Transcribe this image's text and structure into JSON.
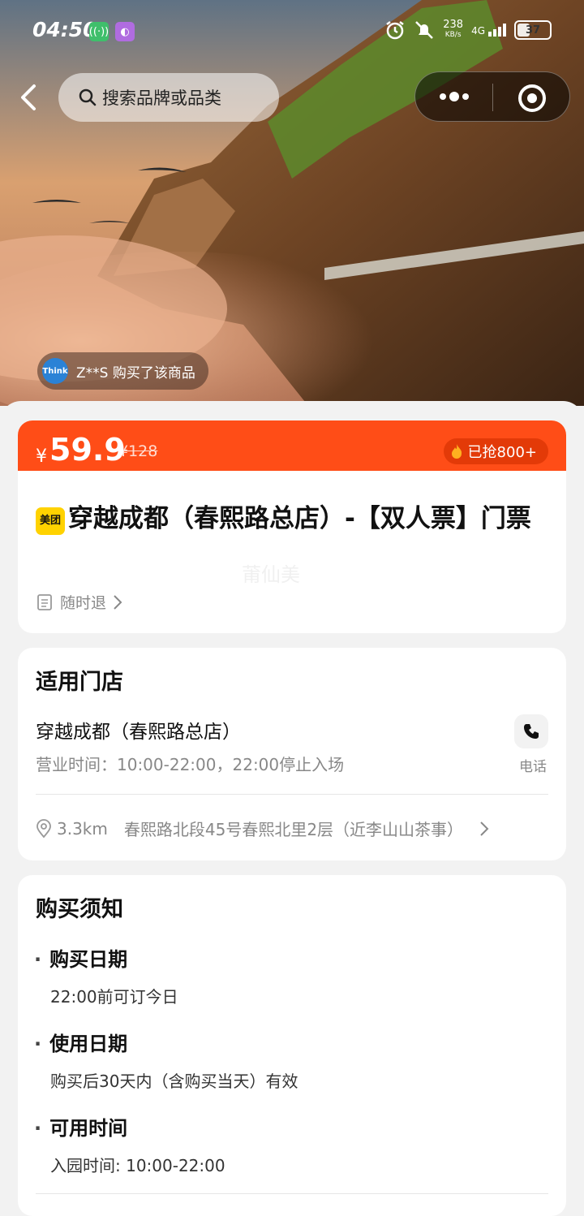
{
  "status_bar": {
    "time": "04:50",
    "net_speed": "238",
    "net_unit": "KB/s",
    "signal": "4G",
    "battery": "37"
  },
  "nav": {
    "search_placeholder": "搜索品牌或品类"
  },
  "hero": {
    "buyer_avatar": "Think",
    "buyer_text": "Z**S 购买了该商品"
  },
  "price": {
    "currency": "¥",
    "current": "59.9",
    "original": "¥128",
    "sold": "已抢800+"
  },
  "product": {
    "brand_badge": "美团",
    "title": "穿越成都（春熙路总店）-【双人票】门票",
    "watermark": "莆仙美",
    "refund": "随时退"
  },
  "store": {
    "heading": "适用门店",
    "name": "穿越成都（春熙路总店）",
    "hours": "营业时间：10:00-22:00，22:00停止入场",
    "call_label": "电话",
    "distance": "3.3km",
    "address": "春熙路北段45号春熙北里2层（近李山山茶事）"
  },
  "notice": {
    "heading": "购买须知",
    "items": [
      {
        "label": "购买日期",
        "value": "22:00前可订今日"
      },
      {
        "label": "使用日期",
        "value": "购买后30天内（含购买当天）有效"
      },
      {
        "label": "可用时间",
        "value": "入园时间: 10:00-22:00"
      }
    ]
  },
  "colors": {
    "accent": "#ff4d17",
    "brand_yellow": "#ffd200"
  }
}
